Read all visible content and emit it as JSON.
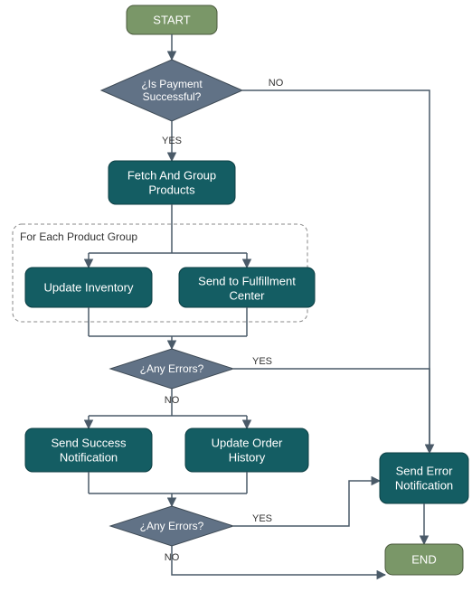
{
  "chart_data": {
    "type": "diagram",
    "title": "",
    "nodes": [
      {
        "id": "start",
        "type": "terminator",
        "label": "START"
      },
      {
        "id": "payment",
        "type": "decision",
        "label": "¿Is Payment Successful?"
      },
      {
        "id": "fetch",
        "type": "process",
        "label": "Fetch And Group Products"
      },
      {
        "id": "update_inv",
        "type": "process",
        "label": "Update Inventory"
      },
      {
        "id": "send_fulfill",
        "type": "process",
        "label": "Send to Fulfillment Center"
      },
      {
        "id": "errors1",
        "type": "decision",
        "label": "¿Any Errors?"
      },
      {
        "id": "send_success",
        "type": "process",
        "label": "Send Success Notification"
      },
      {
        "id": "update_order",
        "type": "process",
        "label": "Update Order History"
      },
      {
        "id": "errors2",
        "type": "decision",
        "label": "¿Any Errors?"
      },
      {
        "id": "send_error",
        "type": "process",
        "label": "Send Error Notification"
      },
      {
        "id": "end",
        "type": "terminator",
        "label": "END"
      }
    ],
    "group": {
      "label": "For Each Product Group",
      "contains": [
        "update_inv",
        "send_fulfill"
      ]
    },
    "edges": [
      {
        "from": "start",
        "to": "payment",
        "label": ""
      },
      {
        "from": "payment",
        "to": "fetch",
        "label": "YES"
      },
      {
        "from": "payment",
        "to": "send_error",
        "label": "NO"
      },
      {
        "from": "fetch",
        "to": "update_inv",
        "label": ""
      },
      {
        "from": "fetch",
        "to": "send_fulfill",
        "label": ""
      },
      {
        "from": "update_inv",
        "to": "errors1",
        "label": ""
      },
      {
        "from": "send_fulfill",
        "to": "errors1",
        "label": ""
      },
      {
        "from": "errors1",
        "to": "send_success",
        "label": "NO"
      },
      {
        "from": "errors1",
        "to": "update_order",
        "label": "NO"
      },
      {
        "from": "errors1",
        "to": "send_error",
        "label": "YES"
      },
      {
        "from": "send_success",
        "to": "errors2",
        "label": ""
      },
      {
        "from": "update_order",
        "to": "errors2",
        "label": ""
      },
      {
        "from": "errors2",
        "to": "end",
        "label": "NO"
      },
      {
        "from": "errors2",
        "to": "send_error",
        "label": "YES"
      },
      {
        "from": "send_error",
        "to": "end",
        "label": ""
      }
    ]
  },
  "labels": {
    "start": "START",
    "payment_l1": "¿Is Payment",
    "payment_l2": "Successful?",
    "yes": "YES",
    "no": "NO",
    "fetch_l1": "Fetch And Group",
    "fetch_l2": "Products",
    "group": "For Each Product Group",
    "update_inv": "Update Inventory",
    "send_fulfill_l1": "Send to Fulfillment",
    "send_fulfill_l2": "Center",
    "errors1": "¿Any Errors?",
    "send_success_l1": "Send Success",
    "send_success_l2": "Notification",
    "update_order_l1": "Update Order",
    "update_order_l2": "History",
    "errors2": "¿Any Errors?",
    "send_error_l1": "Send Error",
    "send_error_l2": "Notification",
    "end": "END"
  }
}
